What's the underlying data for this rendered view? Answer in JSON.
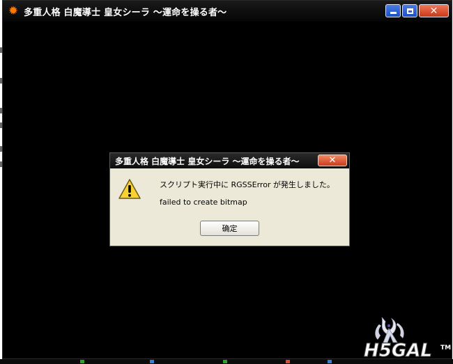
{
  "window": {
    "title": "多重人格 白魔導士 皇女シーラ ～運命を操る者～",
    "controls": {
      "minimize": "minimize",
      "maximize": "maximize",
      "close": "close"
    }
  },
  "dialog": {
    "title": "多重人格 白魔導士 皇女シーラ ～運命を操る者～",
    "message_line1": "スクリプト実行中に RGSSError が発生しました。",
    "message_line2": "failed to create bitmap",
    "ok_label": "确定",
    "icon": "warning-icon"
  },
  "watermark": {
    "text": "H5GAL",
    "tm": "TM"
  },
  "colors": {
    "dialog_bg": "#ece9d8",
    "title_bg": "#000000",
    "close_red": "#d9502e",
    "control_blue": "#2f5fd6",
    "warning_yellow": "#f7d232"
  }
}
